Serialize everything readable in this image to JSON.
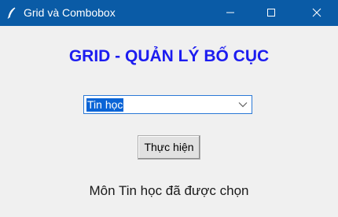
{
  "window": {
    "title": "Grid và Combobox",
    "titlebar_color": "#0a5ba6",
    "icons": {
      "app": "feather-icon",
      "minimize": "minimize-icon",
      "maximize": "maximize-icon",
      "close": "close-icon"
    }
  },
  "main": {
    "heading": "GRID - QUẢN LÝ BỐ CỤC",
    "heading_color": "#1c1cf0",
    "combobox": {
      "selected": "Tin học",
      "selection_color": "#0a64d6",
      "arrow_icon": "chevron-down-icon"
    },
    "run_button_label": "Thực hiện",
    "result_text": "Môn Tin học đã được chọn"
  }
}
